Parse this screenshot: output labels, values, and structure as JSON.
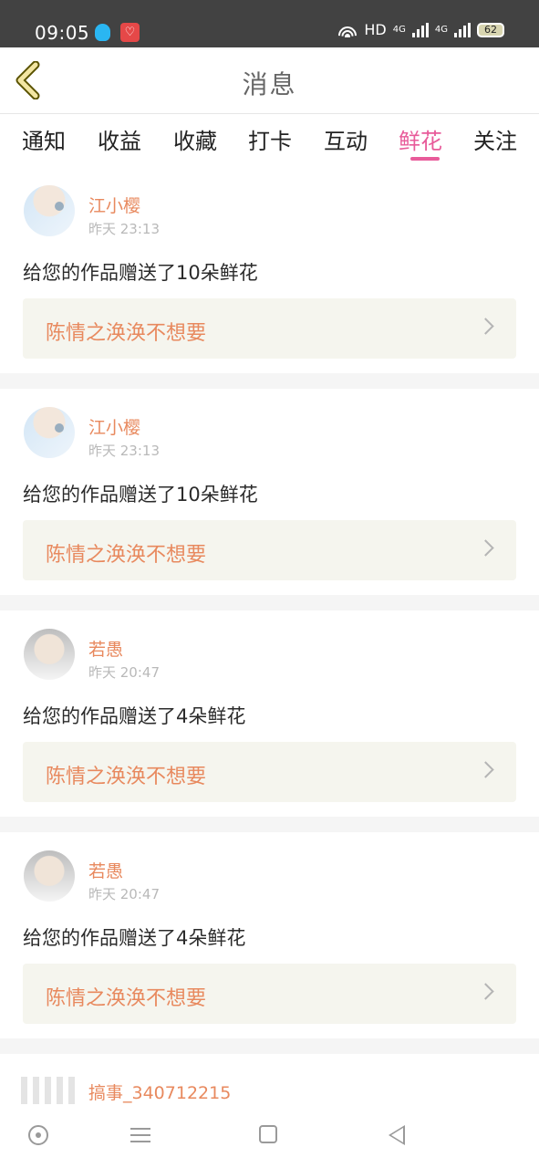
{
  "status": {
    "time": "09:05",
    "app_badge": "♡",
    "hd": "HD",
    "network_1": "4G",
    "network_2": "4G",
    "battery": "62"
  },
  "header": {
    "title": "消息"
  },
  "tabs": [
    {
      "label": "通知"
    },
    {
      "label": "收益"
    },
    {
      "label": "收藏"
    },
    {
      "label": "打卡"
    },
    {
      "label": "互动"
    },
    {
      "label": "鲜花",
      "active": true
    },
    {
      "label": "关注"
    }
  ],
  "messages": [
    {
      "username": "江小樱",
      "time": "昨天 23:13",
      "text": "给您的作品赠送了10朵鲜花",
      "work_title": "陈情之涣涣不想要"
    },
    {
      "username": "江小樱",
      "time": "昨天 23:13",
      "text": "给您的作品赠送了10朵鲜花",
      "work_title": "陈情之涣涣不想要"
    },
    {
      "username": "若愚",
      "time": "昨天 20:47",
      "text": "给您的作品赠送了4朵鲜花",
      "work_title": "陈情之涣涣不想要"
    },
    {
      "username": "若愚",
      "time": "昨天 20:47",
      "text": "给您的作品赠送了4朵鲜花",
      "work_title": "陈情之涣涣不想要"
    }
  ],
  "partial_message": {
    "username": "搞事_340712215"
  },
  "colors": {
    "accent": "#e85b9a",
    "name": "#e8895e",
    "status_bar": "#424242"
  }
}
